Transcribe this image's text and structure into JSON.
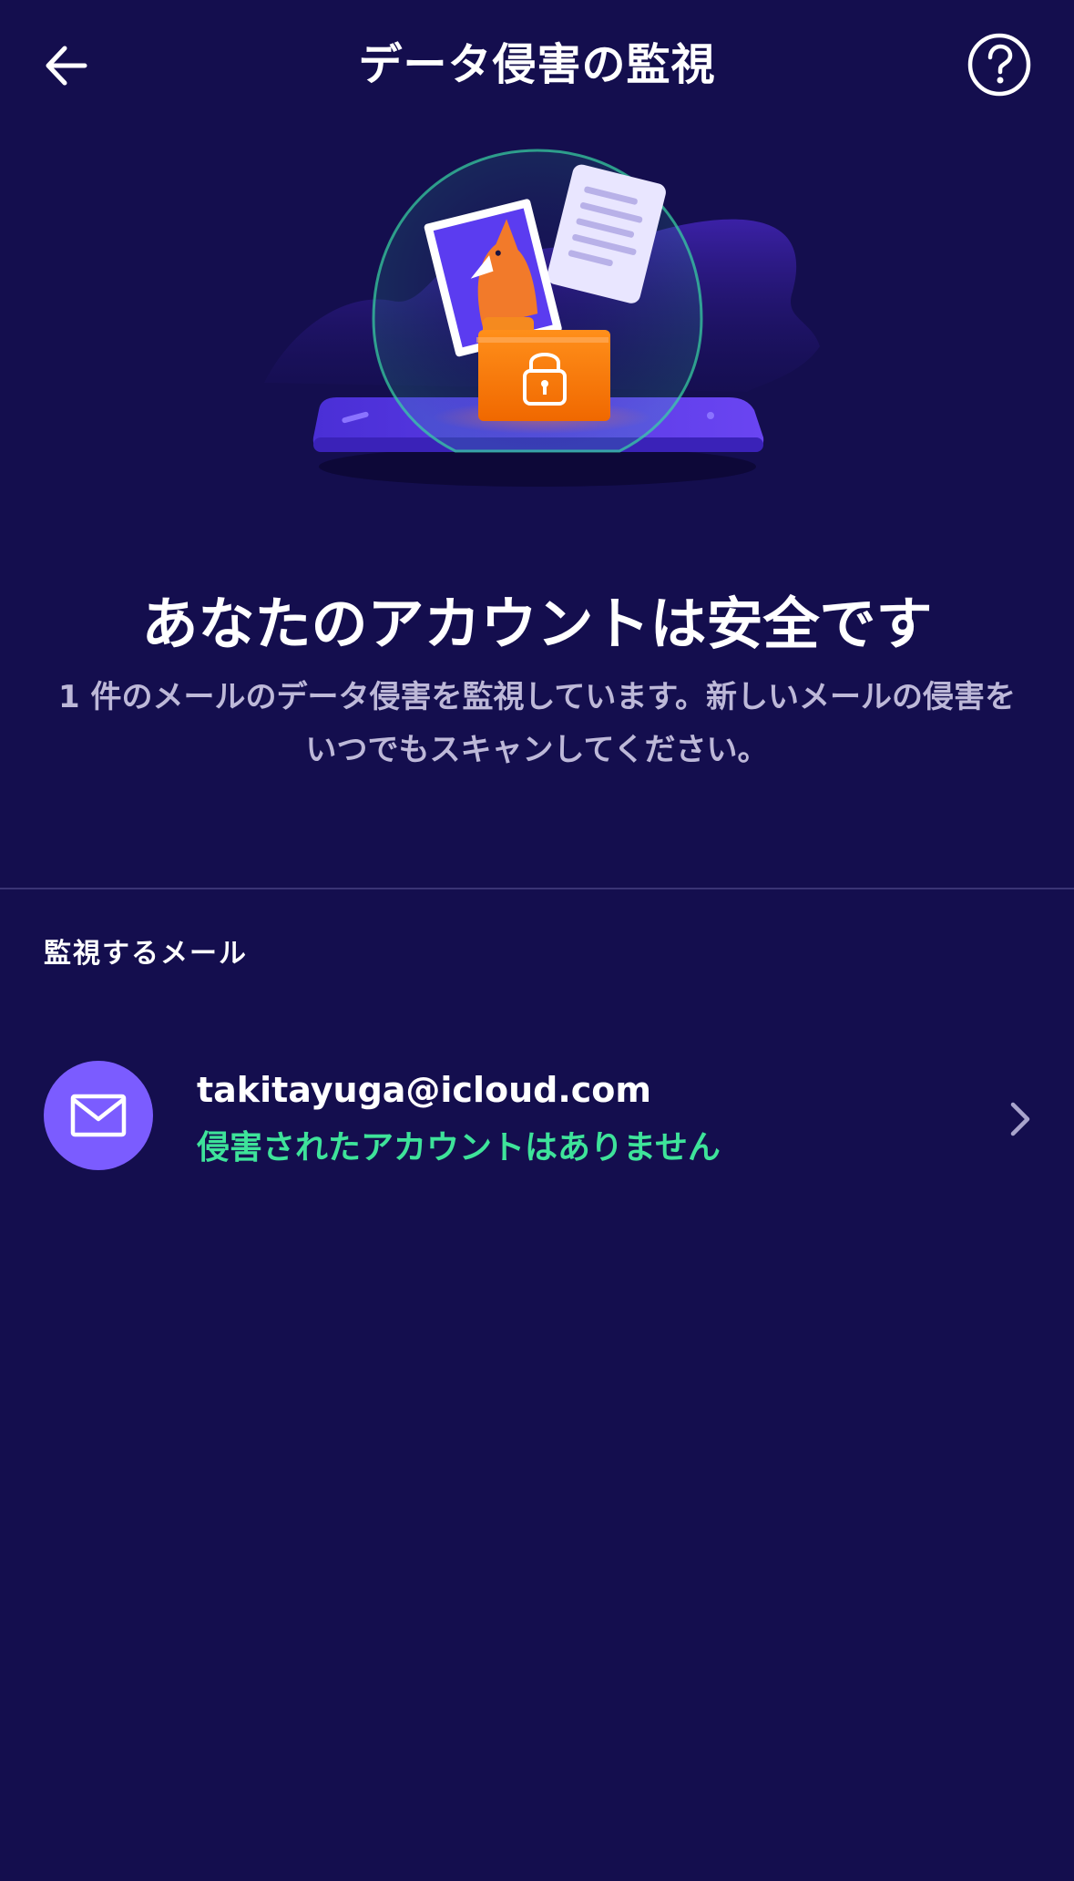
{
  "header": {
    "title": "データ侵害の監視",
    "back_icon": "arrow-left-icon",
    "help_icon": "question-circle-icon"
  },
  "hero": {
    "illustration": "shield-dome-folder-lock-illustration"
  },
  "status": {
    "headline": "あなたのアカウントは安全です",
    "description": "1 件のメールのデータ侵害を監視しています。新しいメールの侵害をいつでもスキャンしてください。"
  },
  "monitored": {
    "section_label": "監視するメール",
    "emails": [
      {
        "address": "takitayuga@icloud.com",
        "status": "侵害されたアカウントはありません",
        "icon": "mail-icon"
      }
    ]
  },
  "colors": {
    "background": "#140e4e",
    "accent": "#7b5cff",
    "safe": "#3ee39a",
    "folder": "#ff7a00"
  }
}
